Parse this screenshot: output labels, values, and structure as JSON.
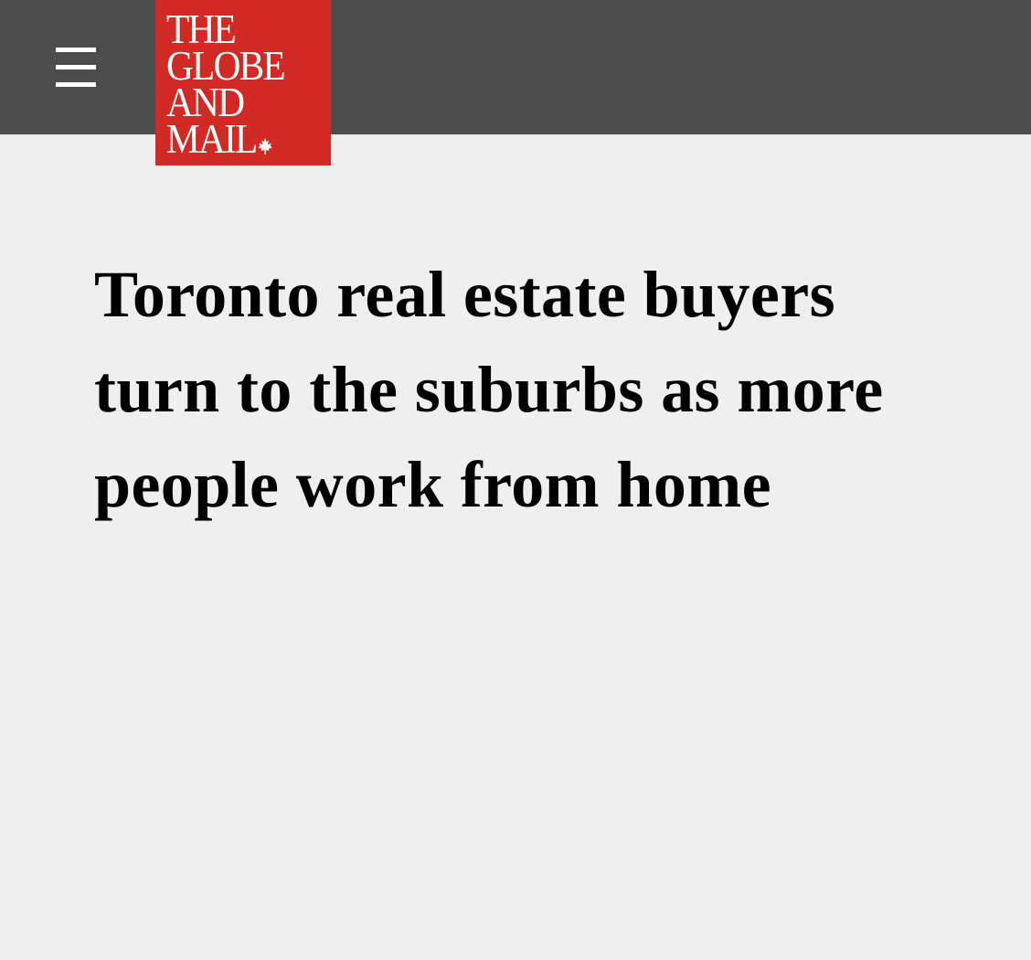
{
  "header": {
    "menu_icon": "hamburger-menu-icon",
    "background_color": "#4d4d4d",
    "logo": {
      "lines": [
        "THE",
        "GLOBE",
        "AND",
        "MAIL"
      ],
      "icon": "maple-leaf-icon",
      "background_color": "#d12a25"
    }
  },
  "article": {
    "headline": "Toronto real estate buyers turn to the suburbs as more people work from home"
  },
  "page": {
    "background_color": "#efefef"
  }
}
